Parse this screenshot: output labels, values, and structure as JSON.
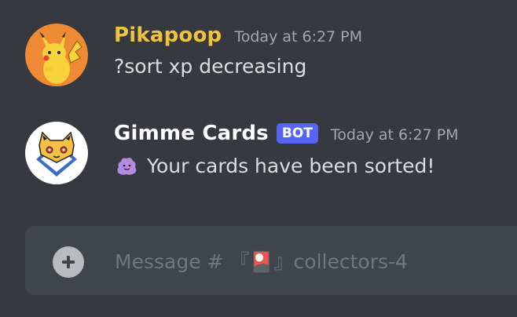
{
  "messages": [
    {
      "username": "Pikapoop",
      "timestamp": "Today at 6:27 PM",
      "content": "?sort xp decreasing",
      "is_bot": false,
      "name_color": "#f0c33f",
      "avatar": "pikachu-avatar"
    },
    {
      "username": "Gimme Cards",
      "badge": "BOT",
      "timestamp": "Today at 6:27 PM",
      "content": "Your cards have been sorted!",
      "emoji": "ditto-emoji",
      "is_bot": true,
      "name_color": "#ffffff",
      "avatar": "gimme-cards-avatar"
    }
  ],
  "composer": {
    "placeholder": "Message # 『🎴』collectors-4",
    "attach_icon": "plus-circle-icon"
  },
  "colors": {
    "background": "#36393f",
    "composer_bg": "#40444b",
    "bot_badge": "#5865f2",
    "timestamp": "#a3a6aa",
    "text": "#dcddde"
  }
}
